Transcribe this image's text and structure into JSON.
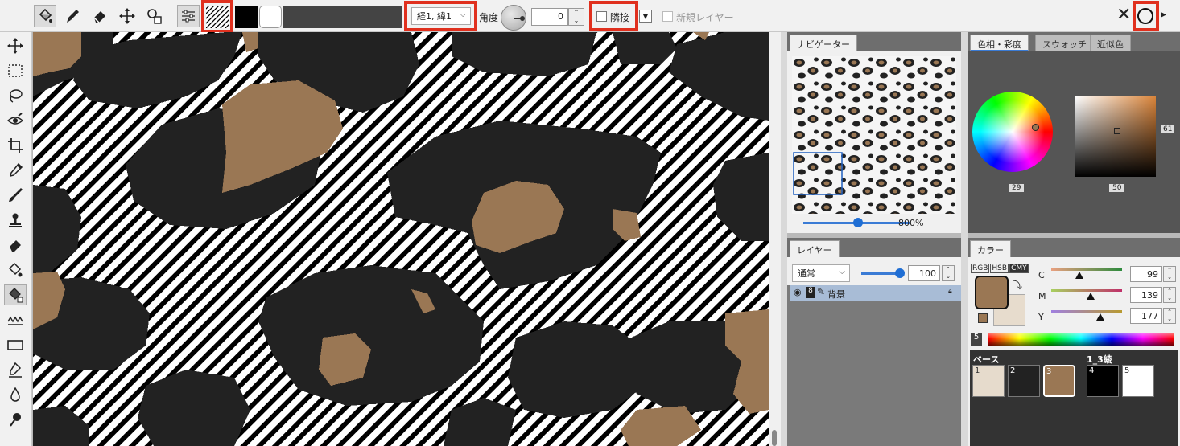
{
  "toolbar": {
    "pattern_combo_value": "経1, 緯1",
    "angle_label": "角度",
    "angle_value": "0",
    "adjacent_label": "隣接",
    "new_layer_label": "新規レイヤー",
    "cancel_glyph": "✕",
    "ok_glyph": "○",
    "colors": {
      "fg": "#000000",
      "bg": "#ffffff",
      "highlight": "#e0301e"
    }
  },
  "left_tools": [
    "move-icon",
    "rect-select-icon",
    "lasso-icon",
    "eye-pen-icon",
    "crop-icon",
    "eyedropper-icon",
    "brush-icon",
    "stamp-icon",
    "eraser-icon",
    "fill-icon",
    "pattern-fill-icon",
    "gradient-icon",
    "rectangle-icon",
    "text-tool-icon",
    "drop-icon",
    "smudge-icon"
  ],
  "navigator": {
    "tab_label": "ナビゲーター",
    "zoom_label": "800%",
    "zoom_fraction": 0.66
  },
  "layers": {
    "tab_label": "レイヤー",
    "blend_mode": "通常",
    "opacity_value": "100",
    "opacity_fraction": 1.0,
    "layer_name": "背景",
    "layer_bits": "8"
  },
  "color_top": {
    "tabs": [
      "色相・彩度",
      "スウォッチ",
      "近似色"
    ],
    "hue_value": "29",
    "sv_value": "50",
    "side_value": "61"
  },
  "color_mixer": {
    "tab_label": "カラー",
    "modes": [
      "RGB",
      "HSB",
      "CMY"
    ],
    "channels": [
      {
        "label": "C",
        "value": "99"
      },
      {
        "label": "M",
        "value": "139"
      },
      {
        "label": "Y",
        "value": "177"
      }
    ],
    "bits_label": "5",
    "current_color": "#9a7754",
    "secondary_color": "#e7dccd"
  },
  "palette": {
    "title_left": "ベース",
    "title_right": "1_3綾",
    "swatches": [
      {
        "num": "1",
        "color": "#e6dbcc"
      },
      {
        "num": "2",
        "color": "#222222"
      },
      {
        "num": "3",
        "color": "#9a7754"
      },
      {
        "num": "4",
        "color": "#000000"
      },
      {
        "num": "5",
        "color": "#ffffff"
      }
    ]
  },
  "canvas_colors": {
    "dark": "#222222",
    "tan": "#9a7754",
    "stripe": "#000000",
    "base": "#ffffff"
  }
}
